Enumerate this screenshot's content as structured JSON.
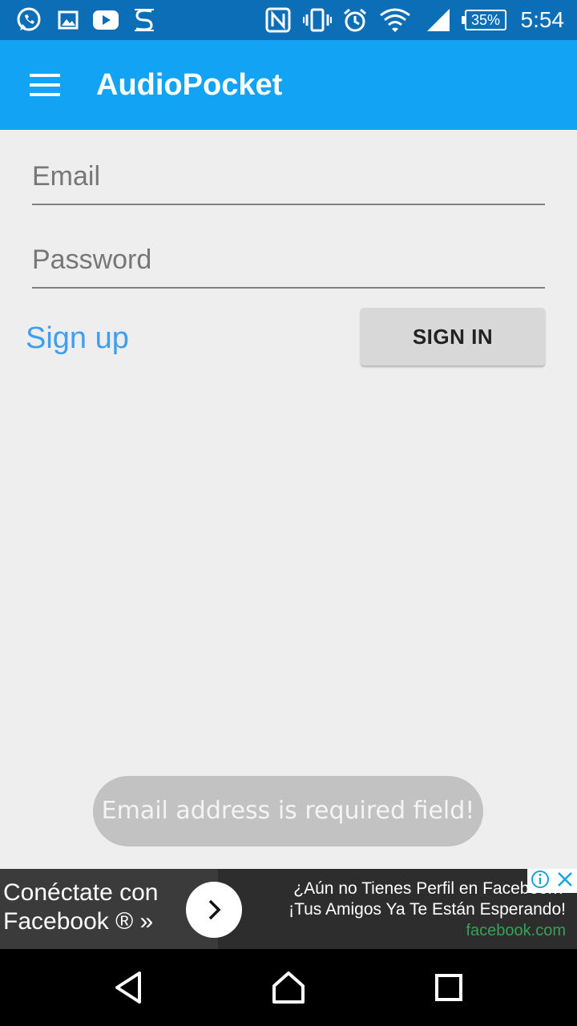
{
  "status_bar": {
    "time": "5:54",
    "battery": "35%",
    "icons": [
      "whatsapp-icon",
      "gallery-icon",
      "youtube-icon",
      "s-app-icon",
      "nfc-icon",
      "vibrate-icon",
      "alarm-icon",
      "wifi-icon",
      "signal-icon",
      "battery-icon"
    ]
  },
  "app_bar": {
    "title": "AudioPocket",
    "menu_icon": "hamburger-menu-icon",
    "color": "#13a3f5"
  },
  "form": {
    "email_placeholder": "Email",
    "email_value": "",
    "password_placeholder": "Password",
    "password_value": "",
    "signup_label": "Sign up",
    "signin_label": "SIGN IN"
  },
  "toast": {
    "message": "Email address is required field!"
  },
  "ad": {
    "cta_line1": "Conéctate con",
    "cta_line2": "Facebook ® »",
    "text_line1": "¿Aún no Tienes Perfil en Facebook?",
    "text_line2": "¡Tus Amigos Ya Te Están Esperando!",
    "domain": "facebook.com"
  },
  "nav_bar": {
    "icons": [
      "back-icon",
      "home-icon",
      "recents-icon"
    ]
  }
}
